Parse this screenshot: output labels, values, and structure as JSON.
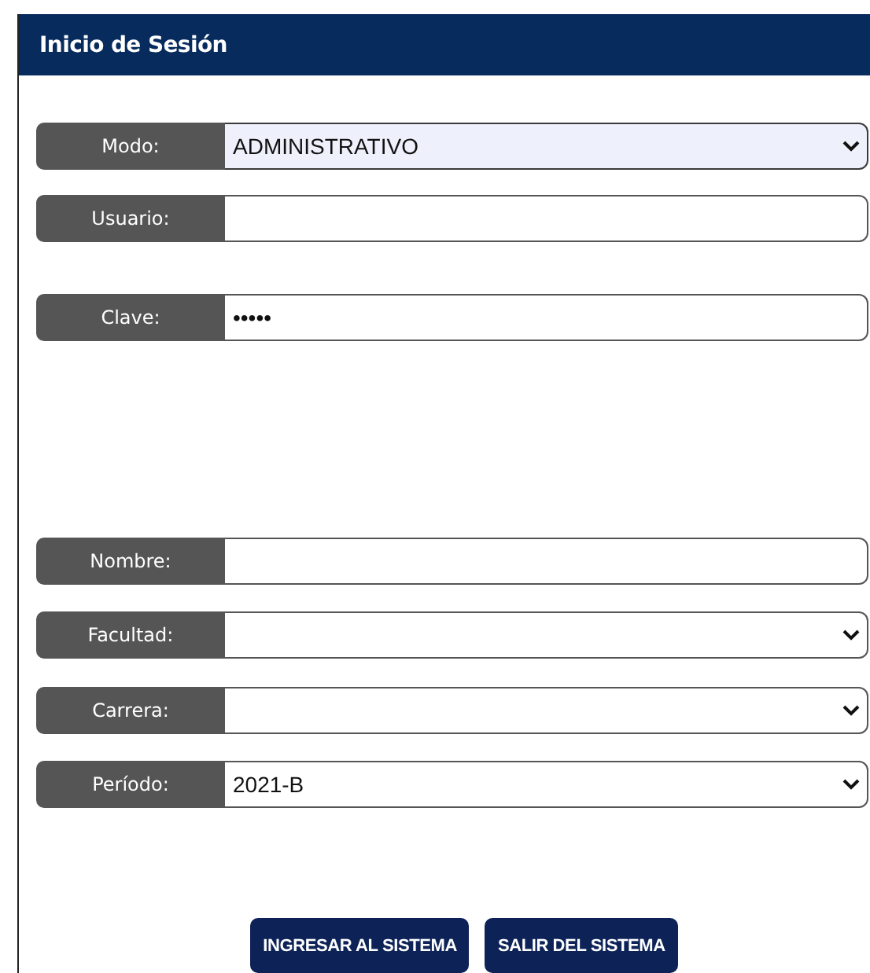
{
  "panel": {
    "title": "Inicio de Sesión"
  },
  "fields": [
    {
      "label": "Modo:",
      "kind": "select",
      "value": "ADMINISTRATIVO",
      "highlighted": true
    },
    {
      "label": "Usuario:",
      "kind": "text"
    },
    {
      "label": "Clave:",
      "kind": "password",
      "value": "•••••"
    },
    {
      "label": "Nombre:",
      "kind": "text"
    },
    {
      "label": "Facultad:",
      "kind": "select"
    },
    {
      "label": "Carrera:",
      "kind": "select"
    },
    {
      "label": "Período:",
      "kind": "select",
      "value": "2021-B"
    }
  ],
  "buttons": [
    "INGRESAR AL SISTEMA",
    "SALIR DEL SISTEMA"
  ]
}
